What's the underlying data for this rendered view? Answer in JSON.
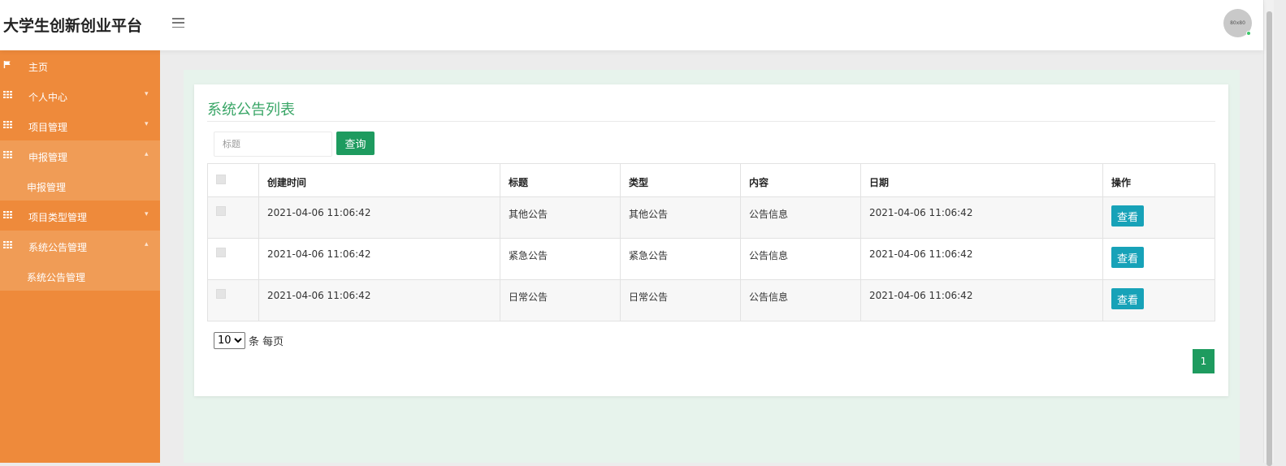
{
  "app": {
    "title": "大学生创新创业平台",
    "avatar_text": "80x80"
  },
  "sidebar": {
    "items": [
      {
        "label": "主页",
        "icon": "flag-icon",
        "arrow": ""
      },
      {
        "label": "个人中心",
        "icon": "grid-icon",
        "arrow": "▾"
      },
      {
        "label": "项目管理",
        "icon": "grid-icon",
        "arrow": "▾"
      },
      {
        "label": "申报管理",
        "icon": "grid-icon",
        "arrow": "▴",
        "sub": "申报管理"
      },
      {
        "label": "项目类型管理",
        "icon": "grid-icon",
        "arrow": "▾"
      },
      {
        "label": "系统公告管理",
        "icon": "grid-icon",
        "arrow": "▴",
        "sub": "系统公告管理"
      }
    ]
  },
  "main": {
    "title": "系统公告列表",
    "search": {
      "placeholder": "标题",
      "button": "查询"
    },
    "table": {
      "headers": [
        "创建时间",
        "标题",
        "类型",
        "内容",
        "日期",
        "操作"
      ],
      "rows": [
        {
          "created": "2021-04-06 11:06:42",
          "title": "其他公告",
          "type": "其他公告",
          "content": "公告信息",
          "date": "2021-04-06 11:06:42",
          "action": "查看"
        },
        {
          "created": "2021-04-06 11:06:42",
          "title": "紧急公告",
          "type": "紧急公告",
          "content": "公告信息",
          "date": "2021-04-06 11:06:42",
          "action": "查看"
        },
        {
          "created": "2021-04-06 11:06:42",
          "title": "日常公告",
          "type": "日常公告",
          "content": "公告信息",
          "date": "2021-04-06 11:06:42",
          "action": "查看"
        }
      ]
    },
    "pagination": {
      "page_size": "10",
      "page_size_suffix": "条 每页",
      "current_page": "1"
    }
  },
  "colors": {
    "sidebar": "#ee8a3b",
    "sidebar_open": "#f09c56",
    "accent_green": "#1e9b5f",
    "title_green": "#3aa667",
    "view_button": "#17a2b8"
  }
}
